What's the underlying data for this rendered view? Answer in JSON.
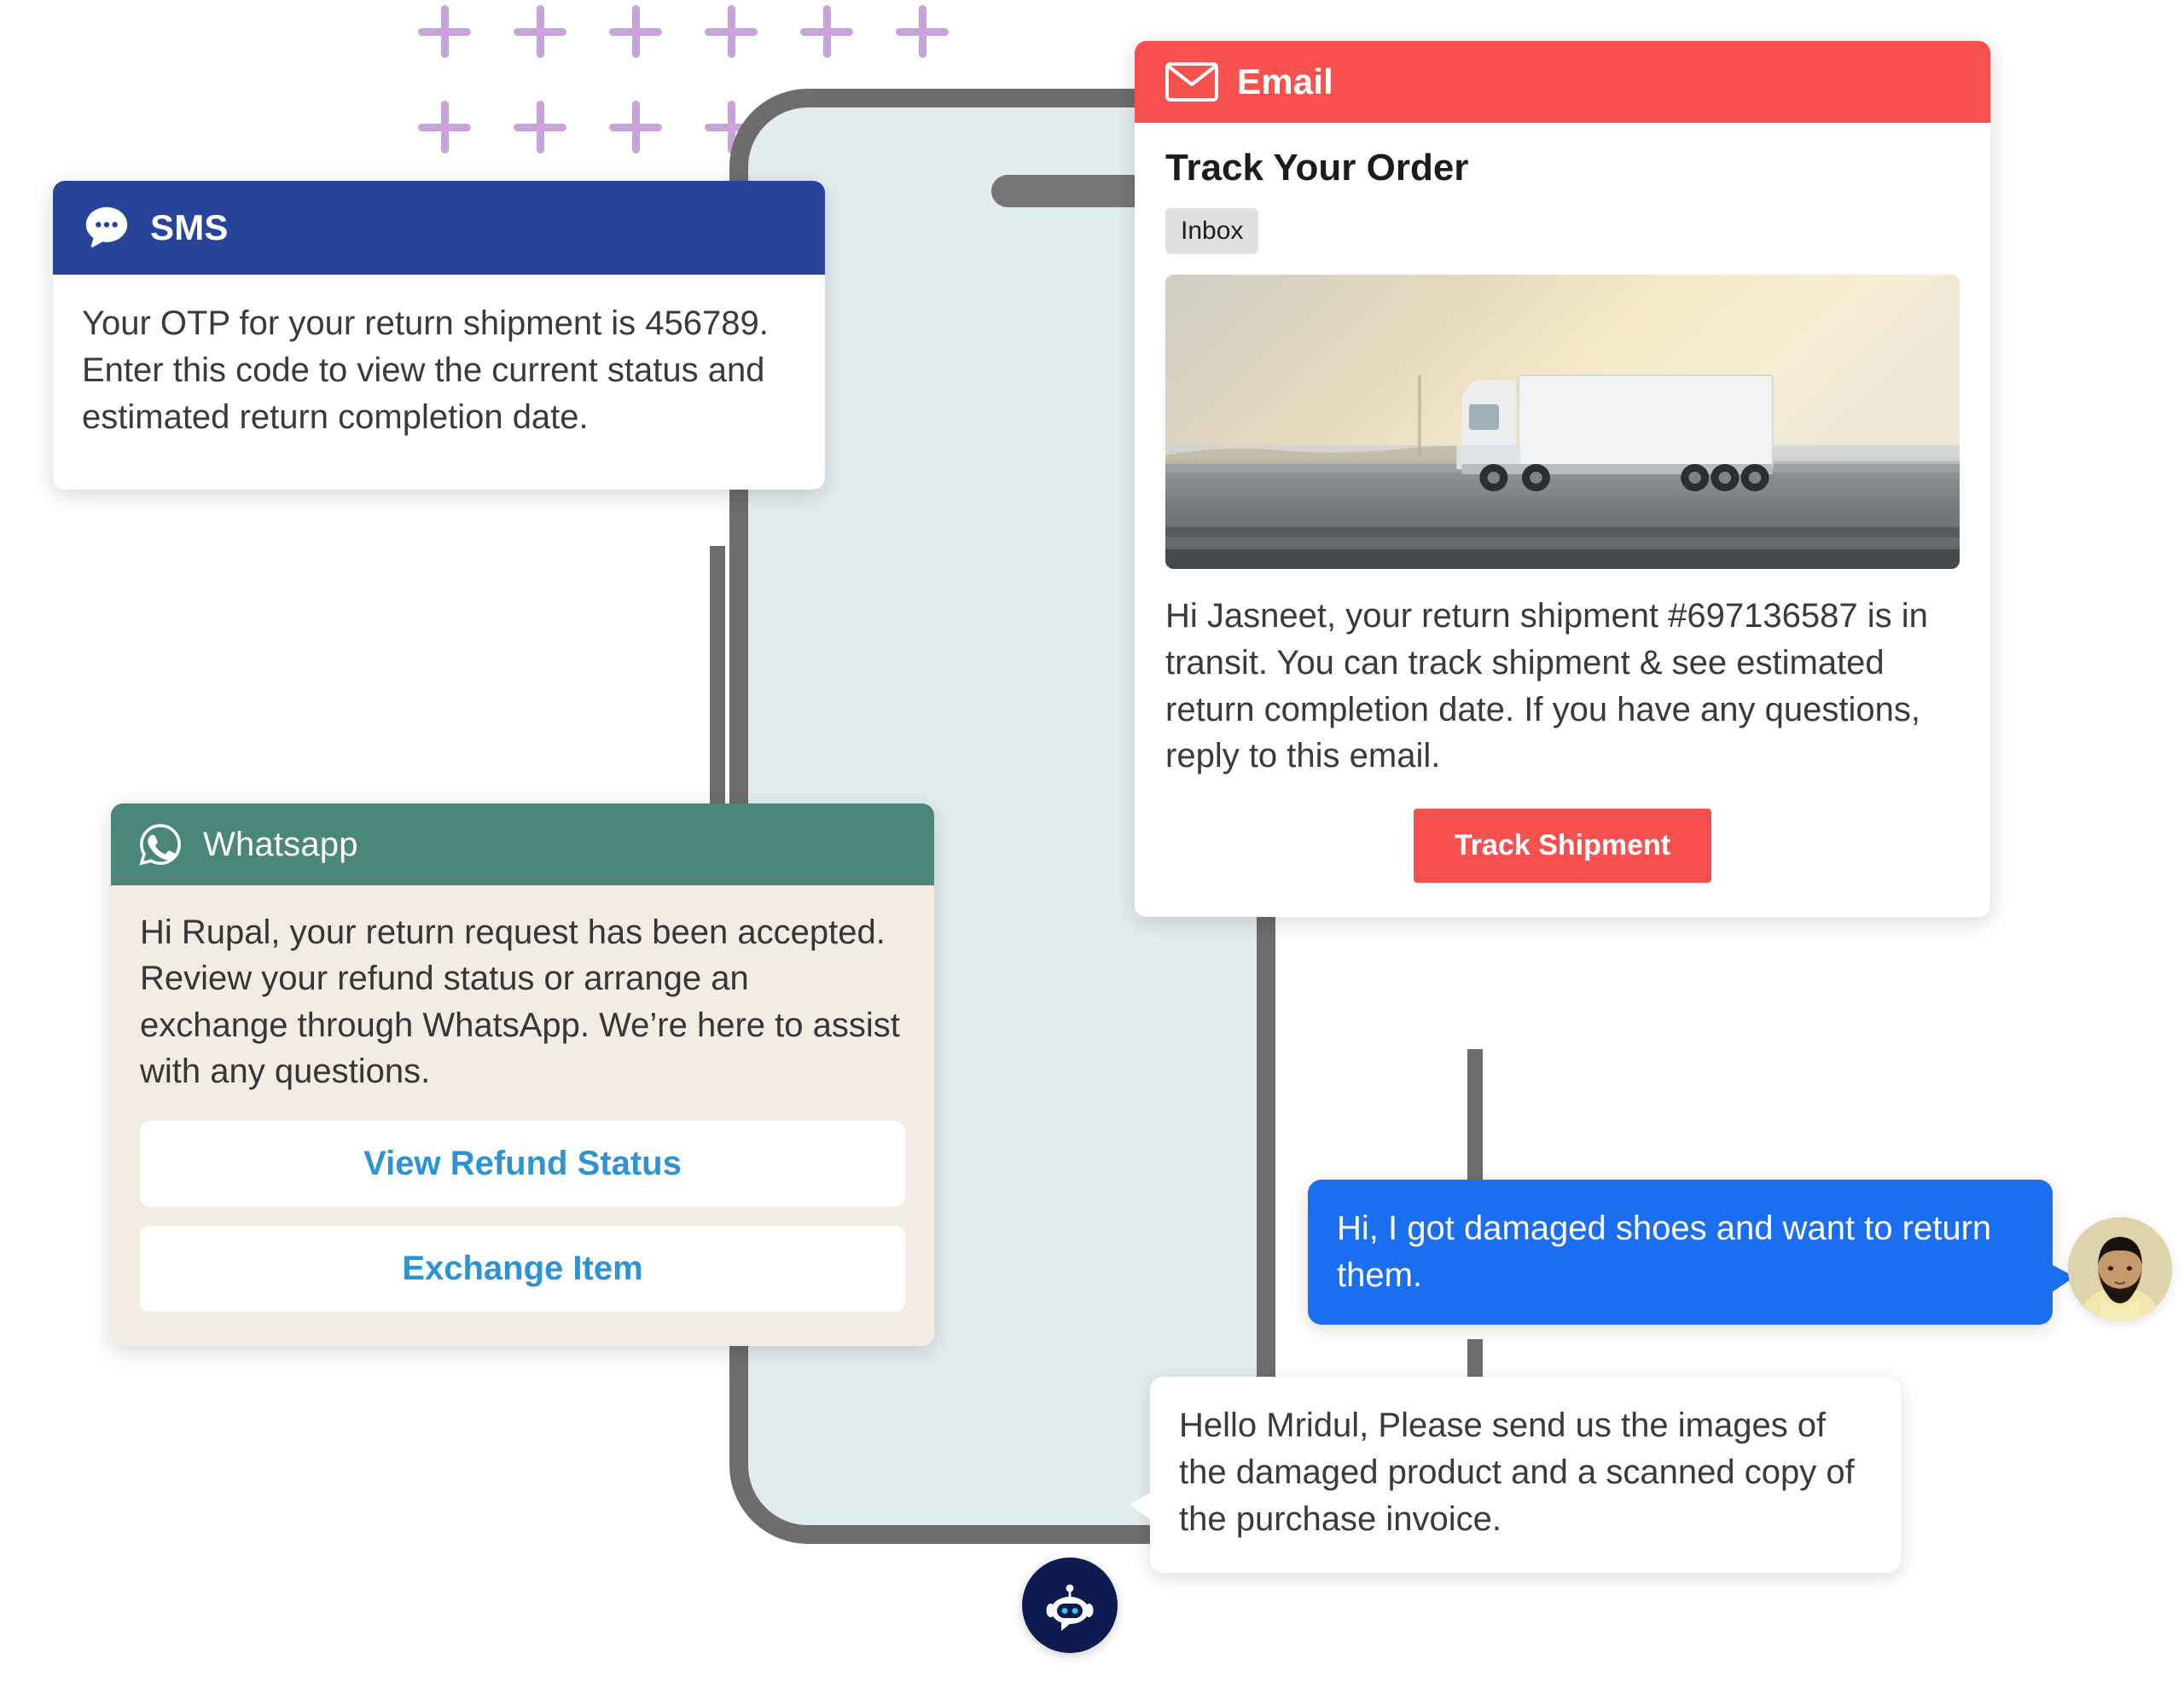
{
  "decor": {
    "plus_icon": "plus-icon",
    "plus_color": "#C9A2D8",
    "row1_count": 6,
    "row2_count": 4
  },
  "phone": {
    "frame_color": "#6E6C6D",
    "screen_color": "#E2EDEF",
    "speaker_color": "#787577"
  },
  "sms_card": {
    "icon": "sms-chat-bubble-icon",
    "channel": "SMS",
    "header_color": "#27449A",
    "message": "Your OTP for your return shipment is 456789. Enter this code to view the current status and estimated return completion date."
  },
  "whatsapp_card": {
    "icon": "whatsapp-icon",
    "channel": "Whatsapp",
    "header_color": "#4A8679",
    "body_color": "#F3ECE3",
    "message": "Hi Rupal, your return request  has been accepted. Review your refund status or arrange an exchange through WhatsApp. We’re here to assist with any questions.",
    "link_color": "#2C93D5",
    "buttons": [
      {
        "label": "View Refund Status"
      },
      {
        "label": "Exchange Item"
      }
    ]
  },
  "email_card": {
    "icon": "envelope-icon",
    "channel": "Email",
    "header_color": "#F6514E",
    "subject": "Track Your Order",
    "badge": "Inbox",
    "hero_image": "white-semi-truck-on-highway-at-sunrise",
    "message": "Hi Jasneet, your return shipment #697136587 is in transit. You can track shipment & see estimated return completion date. If you have any questions, reply to this email.",
    "cta_label": "Track Shipment",
    "cta_color": "#F6514E"
  },
  "chat": {
    "user_message": "Hi, I got damaged shoes and want to return them.",
    "user_bubble_color": "#1B6EF0",
    "avatar": "user-avatar-bearded-man",
    "bot_message": "Hello Mridul, Please send us the images of the damaged product and a scanned copy of the purchase invoice.",
    "bot_icon": "robot-bot-icon",
    "bot_badge_color": "#0D1B51",
    "bot_eye_color": "#21D2F5"
  }
}
